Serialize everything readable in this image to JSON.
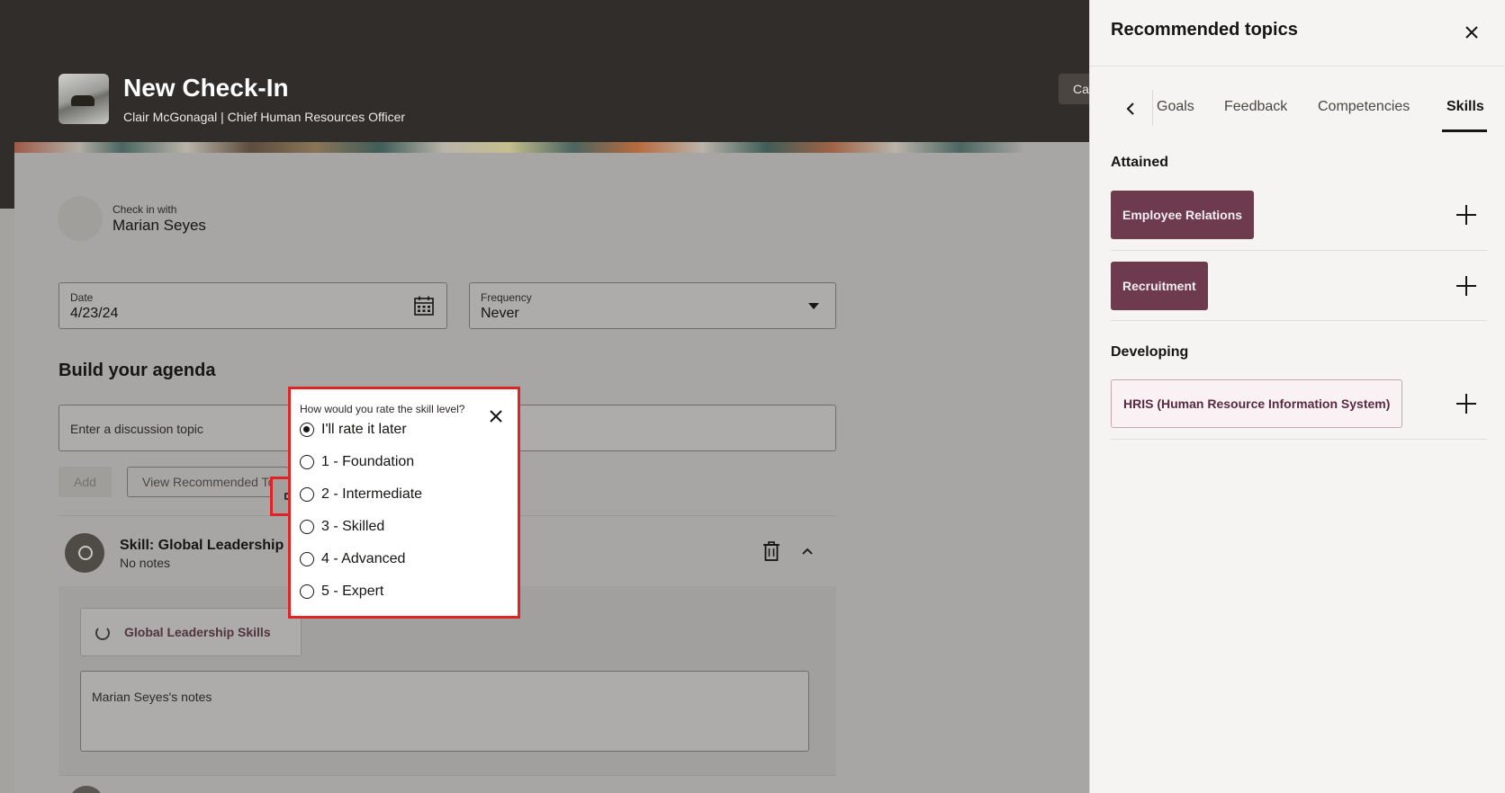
{
  "header": {
    "title": "New Check-In",
    "subtitle": "Clair McGonagal | Chief Human Resources Officer",
    "action_button": "Ca"
  },
  "checkin": {
    "label": "Check in with",
    "name": "Marian Seyes"
  },
  "date_field": {
    "label": "Date",
    "value": "4/23/24"
  },
  "frequency_field": {
    "label": "Frequency",
    "value": "Never"
  },
  "agenda": {
    "title": "Build your agenda",
    "input_placeholder": "Enter a discussion topic",
    "add_label": "Add",
    "view_recommended_label": "View Recommended Topics"
  },
  "skill_item": {
    "title": "Skill: Global Leadership Skills",
    "subtitle": "No notes",
    "chip_label": "Global Leadership Skills",
    "notes_placeholder": "Marian Seyes's notes"
  },
  "rating_popup": {
    "question": "How would you rate the skill level?",
    "selected": "I'll rate it later",
    "options": [
      "I'll rate it later",
      "1 - Foundation",
      "2 - Intermediate",
      "3 - Skilled",
      "4 - Advanced",
      "5 - Expert"
    ]
  },
  "drawer": {
    "title": "Recommended topics",
    "tabs": [
      "Goals",
      "Feedback",
      "Competencies",
      "Skills"
    ],
    "active_tab": "Skills",
    "attained_title": "Attained",
    "attained": [
      "Employee Relations",
      "Recruitment"
    ],
    "developing_title": "Developing",
    "developing": [
      "HRIS (Human Resource Information System)"
    ]
  },
  "colors": {
    "header_bg": "#312d2a",
    "accent_pill": "#6e3a4e",
    "highlight_border": "#e02424"
  }
}
